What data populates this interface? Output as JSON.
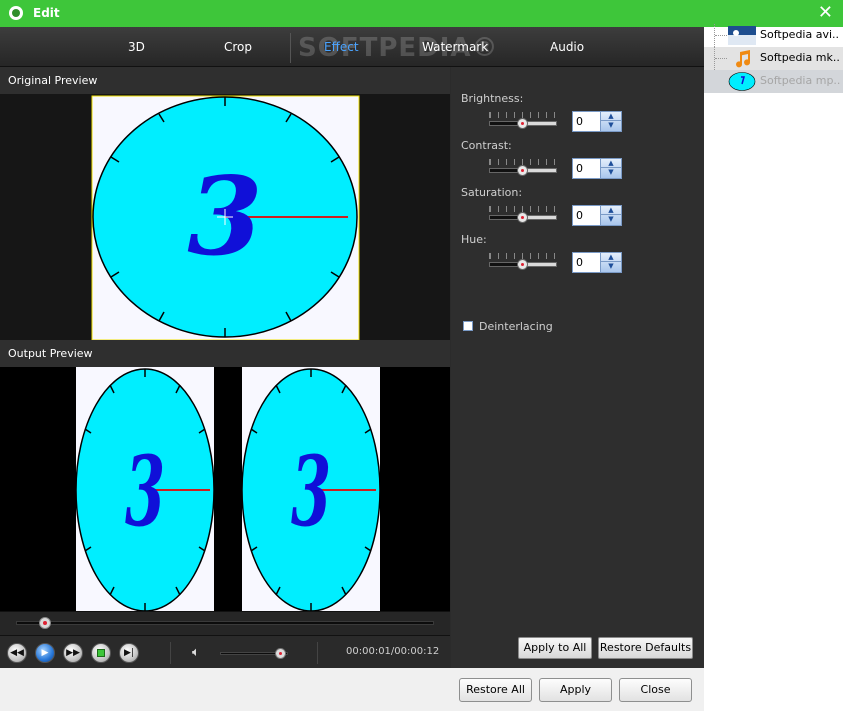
{
  "window": {
    "title": "Edit",
    "close_glyph": "✕"
  },
  "tabs": [
    {
      "label": "3D",
      "active": false
    },
    {
      "label": "Crop",
      "active": false
    },
    {
      "label": "Effect",
      "active": true
    },
    {
      "label": "Watermark",
      "active": false
    },
    {
      "label": "Audio",
      "active": false
    }
  ],
  "watermark_overlay": "SOFTPEDIA®",
  "preview": {
    "original_label": "Original Preview",
    "output_label": "Output Preview",
    "clock_numeral": "3"
  },
  "playback": {
    "time": "00:00:01/00:00:12",
    "position_fraction": 0.07,
    "volume_fraction": 0.9,
    "buttons": [
      "rewind-icon",
      "play-icon",
      "forward-icon",
      "stop-icon",
      "next-frame-icon"
    ]
  },
  "adjustments": [
    {
      "label": "Brightness:",
      "value": "0"
    },
    {
      "label": "Contrast:",
      "value": "0"
    },
    {
      "label": "Saturation:",
      "value": "0"
    },
    {
      "label": "Hue:",
      "value": "0"
    }
  ],
  "deinterlacing": {
    "label": "Deinterlacing",
    "checked": false
  },
  "panel_buttons": {
    "apply_all": "Apply to All",
    "restore_defaults": "Restore Defaults"
  },
  "footer": {
    "restore_all": "Restore All",
    "apply": "Apply",
    "close": "Close"
  },
  "files": [
    {
      "name": "Softpedia avi....",
      "icon": "video-thumbnail-icon"
    },
    {
      "name": "Softpedia mk...",
      "icon": "music-note-icon"
    },
    {
      "name": "Softpedia mp...",
      "icon": "clock-thumbnail-icon"
    }
  ],
  "colors": {
    "titlebar": "#3ec63a",
    "clock_face": "#00eeff",
    "numeral": "#1010d8",
    "hand": "#cc1f1f",
    "active_tab": "#4aa3ff"
  }
}
